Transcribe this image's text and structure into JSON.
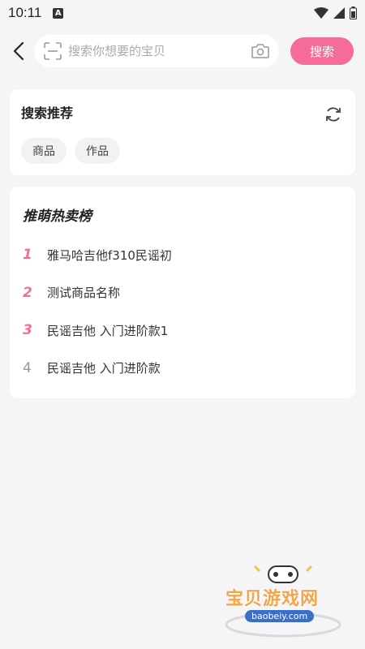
{
  "status": {
    "time": "10:11",
    "notification_glyph": "A"
  },
  "search": {
    "placeholder": "搜索你想要的宝贝",
    "button_label": "搜索"
  },
  "recommend": {
    "title": "搜索推荐",
    "tags": [
      "商品",
      "作品"
    ]
  },
  "hot": {
    "title": "推萌热卖榜",
    "items": [
      {
        "rank": "1",
        "name": "雅马哈吉他f310民谣初"
      },
      {
        "rank": "2",
        "name": "测试商品名称"
      },
      {
        "rank": "3",
        "name": "民谣吉他 入门进阶款1"
      },
      {
        "rank": "4",
        "name": "民谣吉他 入门进阶款"
      }
    ]
  },
  "watermark": {
    "text": "宝贝游戏网",
    "url": "baobeiy.com"
  },
  "colors": {
    "accent": "#f56c98",
    "background": "#f5f5f7"
  }
}
